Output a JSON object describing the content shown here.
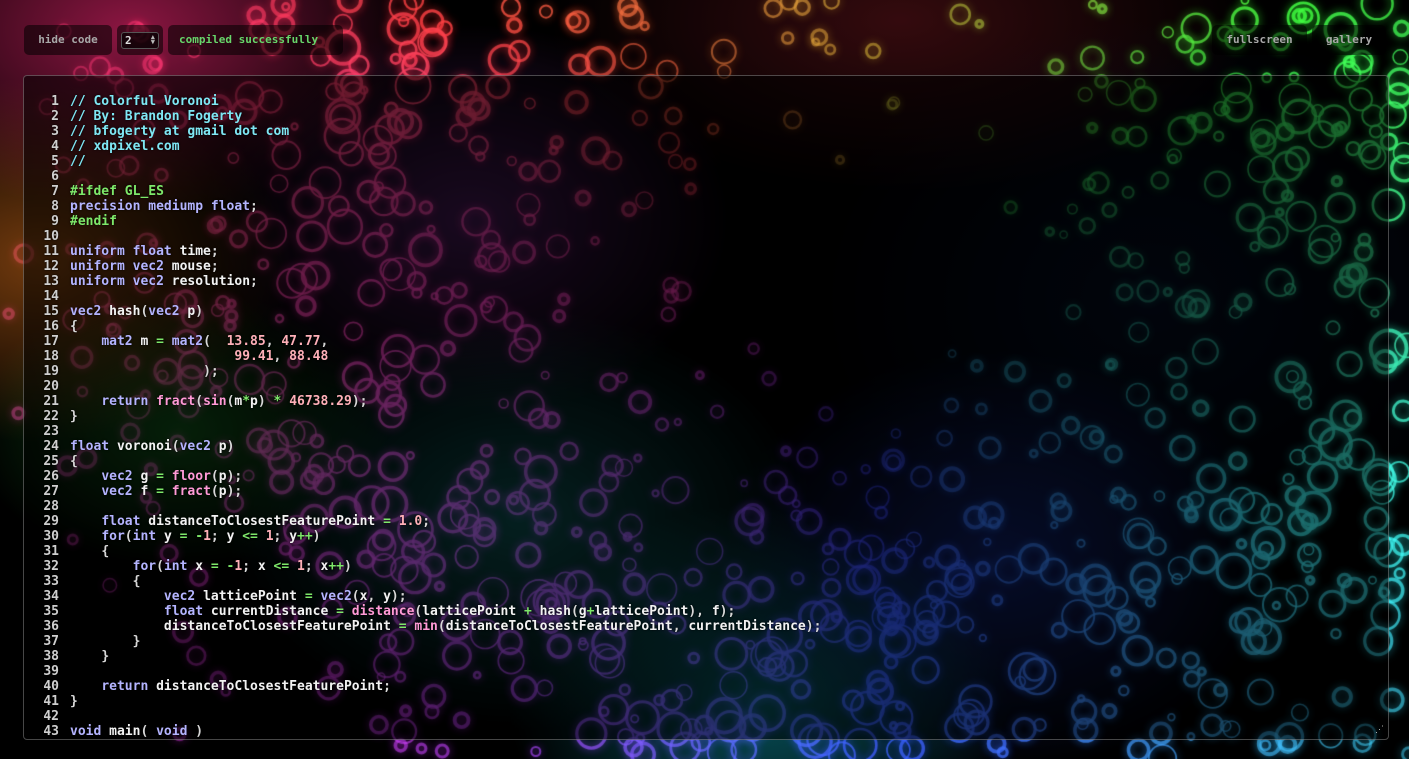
{
  "toolbar": {
    "hide_code_label": "hide code",
    "quality_value": "2",
    "status_text": "compiled successfully",
    "fullscreen_label": "fullscreen",
    "gallery_label": "gallery"
  },
  "colors": {
    "status_ok": "#67d66a",
    "comment": "#7fe7f4",
    "preprocessor": "#7ee86a",
    "keyword": "#b4b4ff",
    "builtin": "#ff9ad6",
    "number": "#ffb0b8"
  },
  "icons": {
    "select_arrows": "updown-arrows-icon",
    "resize_handle": "resize-grip-icon"
  },
  "editor": {
    "lines": [
      [
        [
          "c",
          "// Colorful Voronoi"
        ]
      ],
      [
        [
          "c",
          "// By: Brandon Fogerty"
        ]
      ],
      [
        [
          "c",
          "// bfogerty at gmail dot com"
        ]
      ],
      [
        [
          "c",
          "// xdpixel.com"
        ]
      ],
      [
        [
          "c",
          "//"
        ]
      ],
      [],
      [
        [
          "p",
          "#ifdef GL_ES"
        ]
      ],
      [
        [
          "k",
          "precision mediump float"
        ],
        [
          "u",
          ";"
        ]
      ],
      [
        [
          "p",
          "#endif"
        ]
      ],
      [],
      [
        [
          "k",
          "uniform float "
        ],
        [
          "i",
          "time"
        ],
        [
          "u",
          ";"
        ]
      ],
      [
        [
          "k",
          "uniform vec2 "
        ],
        [
          "i",
          "mouse"
        ],
        [
          "u",
          ";"
        ]
      ],
      [
        [
          "k",
          "uniform vec2 "
        ],
        [
          "i",
          "resolution"
        ],
        [
          "u",
          ";"
        ]
      ],
      [],
      [
        [
          "k",
          "vec2 "
        ],
        [
          "i",
          "hash"
        ],
        [
          "u",
          "("
        ],
        [
          "k",
          "vec2 "
        ],
        [
          "i",
          "p"
        ],
        [
          "u",
          ")"
        ]
      ],
      [
        [
          "u",
          "{"
        ]
      ],
      [
        [
          "i",
          "    "
        ],
        [
          "k",
          "mat2 "
        ],
        [
          "i",
          "m "
        ],
        [
          "o",
          "= "
        ],
        [
          "k",
          "mat2"
        ],
        [
          "u",
          "(  "
        ],
        [
          "n",
          "13.85"
        ],
        [
          "u",
          ", "
        ],
        [
          "n",
          "47.77"
        ],
        [
          "u",
          ","
        ]
      ],
      [
        [
          "i",
          "                     "
        ],
        [
          "n",
          "99.41"
        ],
        [
          "u",
          ", "
        ],
        [
          "n",
          "88.48"
        ]
      ],
      [
        [
          "i",
          "                 "
        ],
        [
          "u",
          ");"
        ]
      ],
      [],
      [
        [
          "i",
          "    "
        ],
        [
          "k",
          "return "
        ],
        [
          "f",
          "fract"
        ],
        [
          "u",
          "("
        ],
        [
          "f",
          "sin"
        ],
        [
          "u",
          "("
        ],
        [
          "i",
          "m"
        ],
        [
          "o",
          "*"
        ],
        [
          "i",
          "p"
        ],
        [
          "u",
          ") "
        ],
        [
          "o",
          "* "
        ],
        [
          "n",
          "46738.29"
        ],
        [
          "u",
          ");"
        ]
      ],
      [
        [
          "u",
          "}"
        ]
      ],
      [],
      [
        [
          "k",
          "float "
        ],
        [
          "i",
          "voronoi"
        ],
        [
          "u",
          "("
        ],
        [
          "k",
          "vec2 "
        ],
        [
          "i",
          "p"
        ],
        [
          "u",
          ")"
        ]
      ],
      [
        [
          "u",
          "{"
        ]
      ],
      [
        [
          "i",
          "    "
        ],
        [
          "k",
          "vec2 "
        ],
        [
          "i",
          "g "
        ],
        [
          "o",
          "= "
        ],
        [
          "f",
          "floor"
        ],
        [
          "u",
          "("
        ],
        [
          "i",
          "p"
        ],
        [
          "u",
          ");"
        ]
      ],
      [
        [
          "i",
          "    "
        ],
        [
          "k",
          "vec2 "
        ],
        [
          "i",
          "f "
        ],
        [
          "o",
          "= "
        ],
        [
          "f",
          "fract"
        ],
        [
          "u",
          "("
        ],
        [
          "i",
          "p"
        ],
        [
          "u",
          ");"
        ]
      ],
      [],
      [
        [
          "i",
          "    "
        ],
        [
          "k",
          "float "
        ],
        [
          "i",
          "distanceToClosestFeaturePoint "
        ],
        [
          "o",
          "= "
        ],
        [
          "n",
          "1.0"
        ],
        [
          "u",
          ";"
        ]
      ],
      [
        [
          "i",
          "    "
        ],
        [
          "k",
          "for"
        ],
        [
          "u",
          "("
        ],
        [
          "k",
          "int "
        ],
        [
          "i",
          "y "
        ],
        [
          "o",
          "= -"
        ],
        [
          "n",
          "1"
        ],
        [
          "u",
          "; "
        ],
        [
          "i",
          "y "
        ],
        [
          "o",
          "<= "
        ],
        [
          "n",
          "1"
        ],
        [
          "u",
          "; "
        ],
        [
          "i",
          "y"
        ],
        [
          "o",
          "++"
        ],
        [
          "u",
          ")"
        ]
      ],
      [
        [
          "i",
          "    "
        ],
        [
          "u",
          "{"
        ]
      ],
      [
        [
          "i",
          "        "
        ],
        [
          "k",
          "for"
        ],
        [
          "u",
          "("
        ],
        [
          "k",
          "int "
        ],
        [
          "i",
          "x "
        ],
        [
          "o",
          "= -"
        ],
        [
          "n",
          "1"
        ],
        [
          "u",
          "; "
        ],
        [
          "i",
          "x "
        ],
        [
          "o",
          "<= "
        ],
        [
          "n",
          "1"
        ],
        [
          "u",
          "; "
        ],
        [
          "i",
          "x"
        ],
        [
          "o",
          "++"
        ],
        [
          "u",
          ")"
        ]
      ],
      [
        [
          "i",
          "        "
        ],
        [
          "u",
          "{"
        ]
      ],
      [
        [
          "i",
          "            "
        ],
        [
          "k",
          "vec2 "
        ],
        [
          "i",
          "latticePoint "
        ],
        [
          "o",
          "= "
        ],
        [
          "k",
          "vec2"
        ],
        [
          "u",
          "("
        ],
        [
          "i",
          "x"
        ],
        [
          "u",
          ", "
        ],
        [
          "i",
          "y"
        ],
        [
          "u",
          ");"
        ]
      ],
      [
        [
          "i",
          "            "
        ],
        [
          "k",
          "float "
        ],
        [
          "i",
          "currentDistance "
        ],
        [
          "o",
          "= "
        ],
        [
          "f",
          "distance"
        ],
        [
          "u",
          "("
        ],
        [
          "i",
          "latticePoint "
        ],
        [
          "o",
          "+ "
        ],
        [
          "i",
          "hash"
        ],
        [
          "u",
          "("
        ],
        [
          "i",
          "g"
        ],
        [
          "o",
          "+"
        ],
        [
          "i",
          "latticePoint"
        ],
        [
          "u",
          "), "
        ],
        [
          "i",
          "f"
        ],
        [
          "u",
          ");"
        ]
      ],
      [
        [
          "i",
          "            "
        ],
        [
          "i",
          "distanceToClosestFeaturePoint "
        ],
        [
          "o",
          "= "
        ],
        [
          "f",
          "min"
        ],
        [
          "u",
          "("
        ],
        [
          "i",
          "distanceToClosestFeaturePoint"
        ],
        [
          "u",
          ", "
        ],
        [
          "i",
          "currentDistance"
        ],
        [
          "u",
          ");"
        ]
      ],
      [
        [
          "i",
          "        "
        ],
        [
          "u",
          "}"
        ]
      ],
      [
        [
          "i",
          "    "
        ],
        [
          "u",
          "}"
        ]
      ],
      [],
      [
        [
          "i",
          "    "
        ],
        [
          "k",
          "return "
        ],
        [
          "i",
          "distanceToClosestFeaturePoint"
        ],
        [
          "u",
          ";"
        ]
      ],
      [
        [
          "u",
          "}"
        ]
      ],
      [],
      [
        [
          "k",
          "void "
        ],
        [
          "i",
          "main"
        ],
        [
          "u",
          "( "
        ],
        [
          "k",
          "void "
        ],
        [
          "u",
          ")"
        ]
      ]
    ]
  }
}
